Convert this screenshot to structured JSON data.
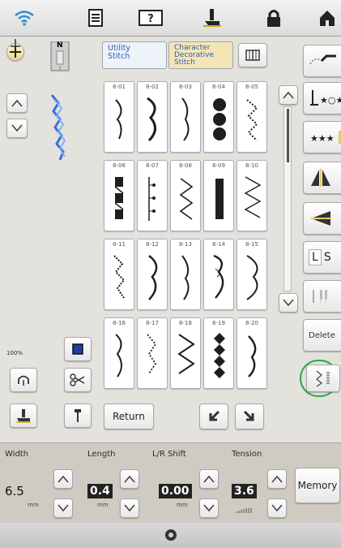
{
  "topbar": {
    "icons": [
      "wifi-icon",
      "document-icon",
      "help-icon",
      "presser-foot-icon",
      "lock-icon",
      "home-icon"
    ]
  },
  "left": {
    "foot_badge": "N",
    "zoom": "100%"
  },
  "tabs": {
    "utility": "Utility\nStitch",
    "decorative": "Character\nDecorative\nStitch"
  },
  "stitches": [
    {
      "id": "8-01"
    },
    {
      "id": "8-02"
    },
    {
      "id": "8-03"
    },
    {
      "id": "8-04"
    },
    {
      "id": "8-05"
    },
    {
      "id": "8-06"
    },
    {
      "id": "8-07"
    },
    {
      "id": "8-08"
    },
    {
      "id": "8-09"
    },
    {
      "id": "8-10"
    },
    {
      "id": "8-11"
    },
    {
      "id": "8-12"
    },
    {
      "id": "8-13"
    },
    {
      "id": "8-14"
    },
    {
      "id": "8-15"
    },
    {
      "id": "8-16"
    },
    {
      "id": "8-17"
    },
    {
      "id": "8-18"
    },
    {
      "id": "8-19"
    },
    {
      "id": "8-20"
    }
  ],
  "return_label": "Return",
  "right": {
    "l_label": "L",
    "s_label": "S",
    "delete_label": "Delete"
  },
  "settings": {
    "width_label": "Width",
    "width_value": "6.5",
    "width_unit": "mm",
    "length_label": "Length",
    "length_value": "0.4",
    "length_unit": "mm",
    "shift_label": "L/R Shift",
    "shift_value": "0.00",
    "shift_unit": "mm",
    "tension_label": "Tension",
    "tension_value": "3.6",
    "memory_label": "Memory"
  },
  "colors": {
    "accent_tab": "#f4e6b4",
    "utility_tab": "#eef3fa",
    "highlight_ring": "#2aa84a",
    "stitch": "#1e1e1e"
  }
}
